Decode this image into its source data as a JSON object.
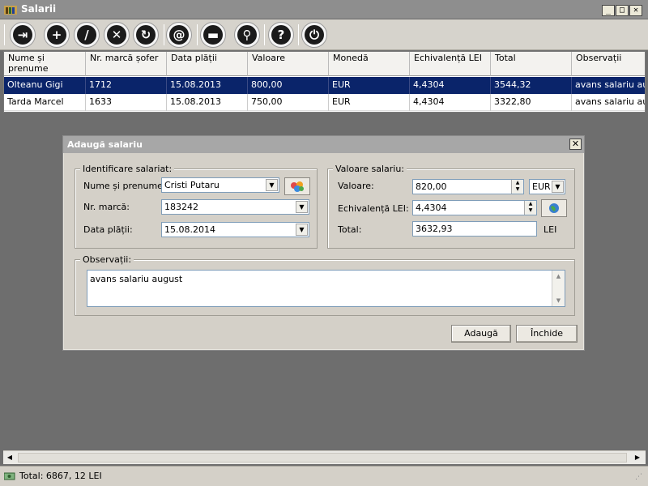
{
  "window": {
    "title": "Salarii",
    "minimize": "_",
    "maximize": "□",
    "close": "✕"
  },
  "toolbar": {
    "buttons": [
      {
        "name": "exit-icon",
        "glyph": "⇥"
      },
      {
        "name": "add-icon",
        "glyph": "+"
      },
      {
        "name": "edit-icon",
        "glyph": "/"
      },
      {
        "name": "delete-icon",
        "glyph": "✕"
      },
      {
        "name": "refresh-icon",
        "glyph": "↻"
      },
      {
        "name": "email-icon",
        "glyph": "@"
      },
      {
        "name": "print-icon",
        "glyph": "▬"
      },
      {
        "name": "search-icon",
        "glyph": "⚲"
      },
      {
        "name": "help-icon",
        "glyph": "?"
      },
      {
        "name": "power-icon",
        "glyph": "⏻"
      }
    ]
  },
  "grid": {
    "columns": [
      "Nume și prenume",
      "Nr. marcă șofer",
      "Data plății",
      "Valoare",
      "Monedă",
      "Echivalență LEI",
      "Total",
      "Observații"
    ],
    "rows": [
      [
        "Olteanu Gigi",
        "1712",
        "15.08.2013",
        "800,00",
        "EUR",
        "4,4304",
        "3544,32",
        "avans salariu aug..."
      ],
      [
        "Tarda Marcel",
        "1633",
        "15.08.2013",
        "750,00",
        "EUR",
        "4,4304",
        "3322,80",
        "avans salariu aug..."
      ]
    ],
    "selected_row": 0
  },
  "dialog": {
    "title": "Adaugă salariu",
    "close": "✕",
    "employee_group": {
      "title": "Identificare salariat:",
      "name_label": "Nume și prenume:",
      "name_value": "Cristi Putaru",
      "mark_label": "Nr. marcă:",
      "mark_value": "183242",
      "date_label": "Data plății:",
      "date_value": "15.08.2014"
    },
    "salary_group": {
      "title": "Valoare salariu:",
      "value_label": "Valoare:",
      "value_value": "820,00",
      "currency_value": "EUR",
      "lei_label": "Echivalență LEI:",
      "lei_value": "4,4304",
      "total_label": "Total:",
      "total_value": "3632,93",
      "total_unit": "LEI"
    },
    "notes_group": {
      "title": "Observații:",
      "value": "avans salariu august"
    },
    "add_button": "Adaugă",
    "close_button": "Închide"
  },
  "status": {
    "total": "Total: 6867, 12 LEI"
  },
  "colors": {
    "selection": "#0a246a",
    "title_bar": "#8e8e8e",
    "dialog_bg": "#d4d0c8"
  }
}
